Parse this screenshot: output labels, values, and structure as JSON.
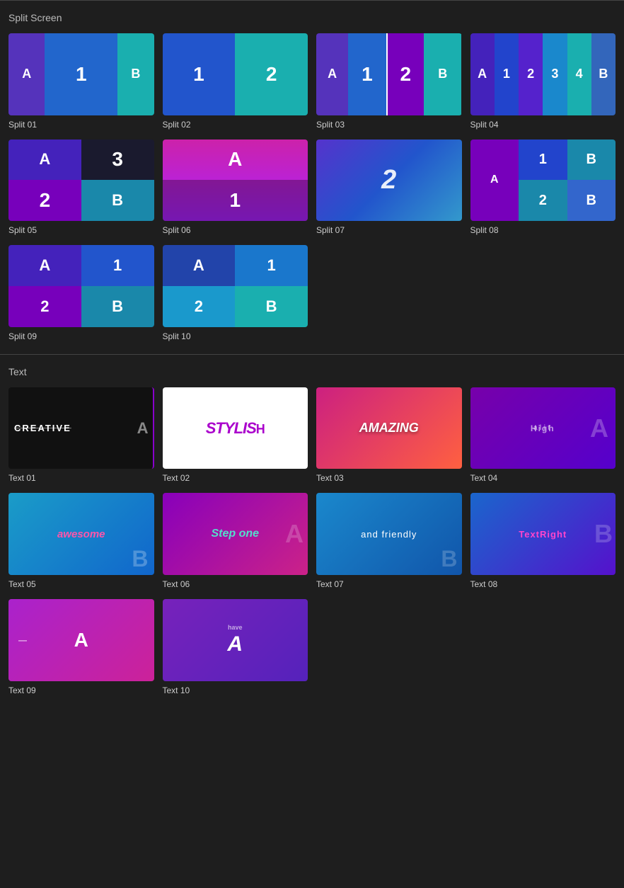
{
  "sections": {
    "split": {
      "title": "Split Screen",
      "items": [
        {
          "label": "Split 01"
        },
        {
          "label": "Split 02"
        },
        {
          "label": "Split 03"
        },
        {
          "label": "Split 04"
        },
        {
          "label": "Split 05"
        },
        {
          "label": "Split 06"
        },
        {
          "label": "Split 07"
        },
        {
          "label": "Split 08"
        },
        {
          "label": "Split 09"
        },
        {
          "label": "Split 10"
        }
      ]
    },
    "text": {
      "title": "Text",
      "items": [
        {
          "label": "Text 01"
        },
        {
          "label": "Text 02"
        },
        {
          "label": "Text 03"
        },
        {
          "label": "Text 04"
        },
        {
          "label": "Text 05"
        },
        {
          "label": "Text 06"
        },
        {
          "label": "Text 07"
        },
        {
          "label": "Text 08"
        },
        {
          "label": "Text 09"
        },
        {
          "label": "Text 10"
        }
      ]
    }
  }
}
